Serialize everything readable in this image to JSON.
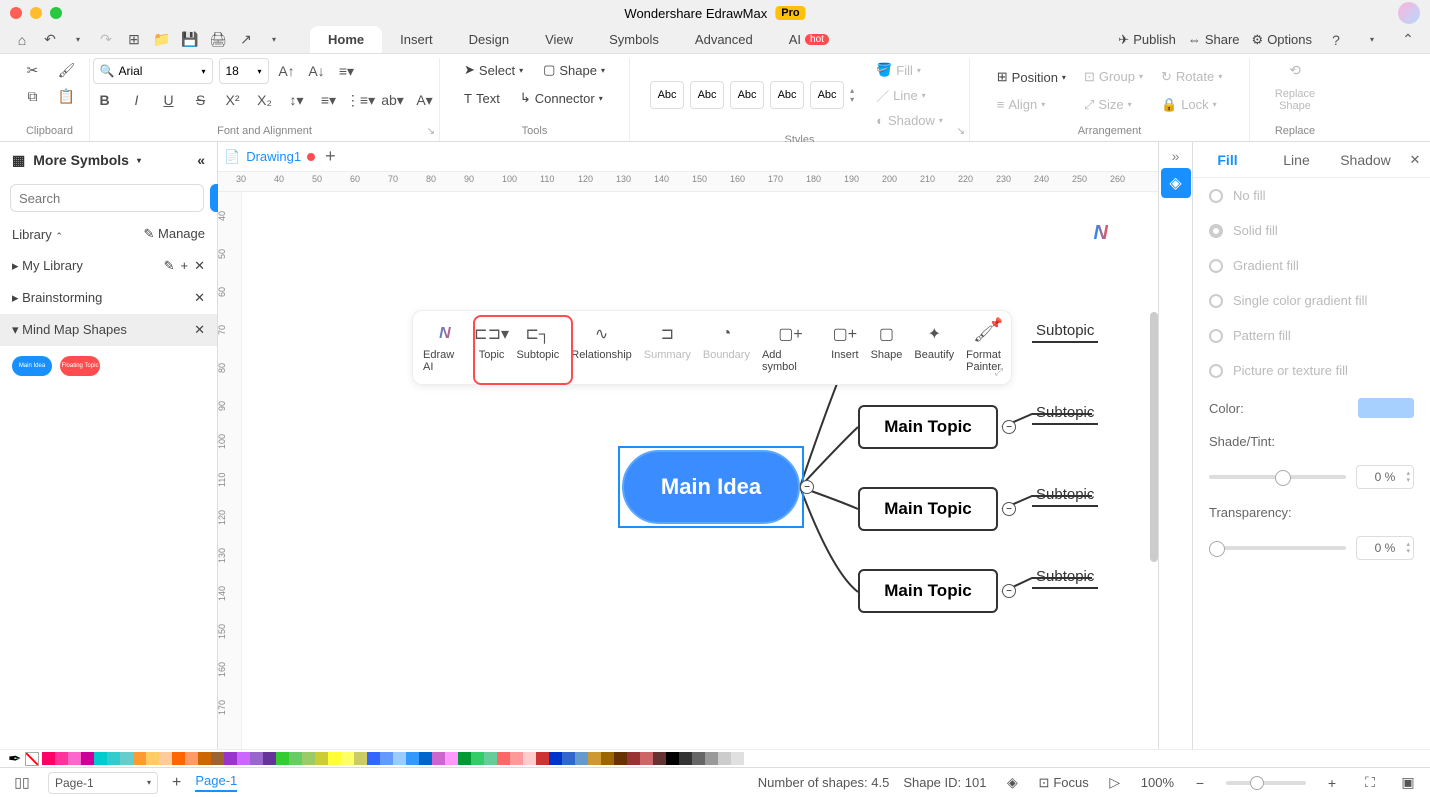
{
  "app": {
    "title": "Wondershare EdrawMax",
    "badge": "Pro"
  },
  "quickbar": {
    "publish": "Publish",
    "share": "Share",
    "options": "Options"
  },
  "menu": {
    "home": "Home",
    "insert": "Insert",
    "design": "Design",
    "view": "View",
    "symbols": "Symbols",
    "advanced": "Advanced",
    "ai": "AI",
    "hot": "hot"
  },
  "ribbon": {
    "clipboard": "Clipboard",
    "font_alignment": "Font and Alignment",
    "font": "Arial",
    "size": "18",
    "tools": "Tools",
    "select": "Select",
    "shape": "Shape",
    "text": "Text",
    "connector": "Connector",
    "styles": "Styles",
    "style_label": "Abc",
    "fill": "Fill",
    "line": "Line",
    "shadow": "Shadow",
    "arrangement": "Arrangement",
    "position": "Position",
    "align": "Align",
    "group": "Group",
    "size_lbl": "Size",
    "rotate": "Rotate",
    "lock": "Lock",
    "replace": "Replace",
    "replace_shape": "Replace\nShape"
  },
  "left": {
    "more_symbols": "More Symbols",
    "search_ph": "Search",
    "search_btn": "Search",
    "library": "Library",
    "manage": "Manage",
    "my_library": "My Library",
    "brainstorming": "Brainstorming",
    "mindmap": "Mind Map Shapes",
    "thumb1": "Main Idea",
    "thumb2": "Floating Topic"
  },
  "doc": {
    "name": "Drawing1",
    "add": "+"
  },
  "ruler_h": [
    "30",
    "40",
    "50",
    "60",
    "70",
    "80",
    "90",
    "100",
    "110",
    "120",
    "130",
    "140",
    "150",
    "160",
    "170",
    "180",
    "190",
    "200",
    "210",
    "220",
    "230",
    "240",
    "250",
    "260"
  ],
  "ruler_v": [
    "40",
    "50",
    "60",
    "70",
    "80",
    "90",
    "100",
    "110",
    "120",
    "130",
    "140",
    "150",
    "160",
    "170"
  ],
  "float": {
    "edraw_ai": "Edraw AI",
    "topic": "Topic",
    "subtopic": "Subtopic",
    "relationship": "Relationship",
    "summary": "Summary",
    "boundary": "Boundary",
    "add_symbol": "Add symbol",
    "insert": "Insert",
    "shape": "Shape",
    "beautify": "Beautify",
    "format_painter": "Format\nPainter"
  },
  "mm": {
    "main": "Main Idea",
    "topic": "Main Topic",
    "sub": "Subtopic"
  },
  "right": {
    "fill": "Fill",
    "line": "Line",
    "shadow": "Shadow",
    "no_fill": "No fill",
    "solid": "Solid fill",
    "gradient": "Gradient fill",
    "single": "Single color gradient fill",
    "pattern": "Pattern fill",
    "picture": "Picture or texture fill",
    "color": "Color:",
    "shade": "Shade/Tint:",
    "transparency": "Transparency:",
    "pct0": "0 %"
  },
  "status": {
    "page_sel": "Page-1",
    "page_link": "Page-1",
    "shapes": "Number of shapes: 4.5",
    "shape_id": "Shape ID: 101",
    "focus": "Focus",
    "zoom": "100%"
  },
  "colors": [
    "#ff0066",
    "#ff3399",
    "#ff66cc",
    "#cc0099",
    "#00cccc",
    "#33cccc",
    "#66cccc",
    "#ff9933",
    "#ffcc66",
    "#ffcc99",
    "#ff6600",
    "#ff9966",
    "#cc6600",
    "#996633",
    "#9933cc",
    "#cc66ff",
    "#9966cc",
    "#663399",
    "#33cc33",
    "#66cc66",
    "#99cc66",
    "#cccc33",
    "#ffff33",
    "#ffff66",
    "#cccc66",
    "#3366ff",
    "#6699ff",
    "#99ccff",
    "#3399ff",
    "#0066cc",
    "#cc66cc",
    "#ff99ff",
    "#009933",
    "#33cc66",
    "#66cc99",
    "#ff6666",
    "#ff9999",
    "#ffcccc",
    "#cc3333",
    "#0033cc",
    "#3366cc",
    "#6699cc",
    "#cc9933",
    "#996600",
    "#663300",
    "#993333",
    "#cc6666",
    "#663333",
    "#000000",
    "#333333",
    "#666666",
    "#999999",
    "#cccccc",
    "#e0e0e0"
  ]
}
